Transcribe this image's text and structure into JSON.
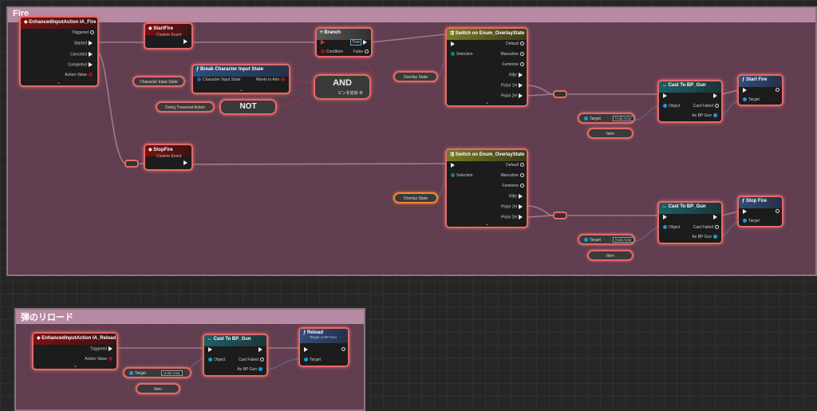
{
  "comments": {
    "fire_title": "Fire",
    "reload_title": "弾のリロード"
  },
  "fire": {
    "ia_fire": {
      "title": "EnhancedInputAction IA_Fire",
      "pins": [
        "Triggered",
        "Started",
        "Canceled",
        "Completed",
        "Action Value"
      ]
    },
    "start_fire_event": {
      "title": "StartFire",
      "subtitle": "Custom Event"
    },
    "stop_fire_event": {
      "title": "StopFire",
      "subtitle": "Custom Event"
    },
    "branch": {
      "title": "Branch",
      "condition": "Condition",
      "true": "True",
      "false": "False"
    },
    "break_state": {
      "title": "Break Character Input State",
      "in_pin": "Character Input State",
      "out_pin": "Wants to Aim"
    },
    "char_input_state_var": "Character Input State",
    "doing_traversal_var": "Doing Traversal Action",
    "not_label": "NOT",
    "and_label": "AND",
    "and_add_pin": "ピンを追加",
    "switch_top": {
      "title": "Switch on Enum_OverlayState",
      "selection": "Selection",
      "outs": [
        "Default",
        "Masculine",
        "Feminine",
        "Rifle",
        "Pistol 1H",
        "Pistol 2H"
      ]
    },
    "switch_bottom": {
      "title": "Switch on Enum_OverlayState",
      "selection": "Selection",
      "outs": [
        "Default",
        "Masculine",
        "Feminine",
        "Rifle",
        "Pistol 1H",
        "Pistol 2H"
      ]
    },
    "overlay_state_top": "Overlay State",
    "overlay_state_bottom": "Overlay State",
    "cast_top": {
      "title": "Cast To BP_Gun",
      "object": "Object",
      "failed": "Cast Failed",
      "as": "As BP Gun"
    },
    "cast_bottom": {
      "title": "Cast To BP_Gun",
      "object": "Object",
      "failed": "Cast Failed",
      "as": "As BP Gun"
    },
    "get_item_top": {
      "target": "Target",
      "value": "Hold Actor",
      "item": "Item"
    },
    "get_item_bottom": {
      "target": "Target",
      "value": "Hold Actor",
      "item": "Item"
    },
    "start_fire_call": {
      "title": "Start Fire",
      "target": "Target"
    },
    "stop_fire_call": {
      "title": "Stop Fire",
      "target": "Target"
    }
  },
  "reload": {
    "ia_reload": {
      "title": "EnhancedInputAction IA_Reload",
      "pins": [
        "Triggered",
        "Action Value"
      ]
    },
    "cast": {
      "title": "Cast To BP_Gun",
      "object": "Object",
      "failed": "Cast Failed",
      "as": "As BP Gun"
    },
    "get_item": {
      "target": "Target",
      "value": "Hold Actor",
      "item": "Item"
    },
    "reload_call": {
      "title": "Reload",
      "subtitle": "Target is BP Gun",
      "target": "Target"
    }
  },
  "colors": {
    "exec": "#ffffff",
    "bool": "#a11010",
    "object": "#1a9bdc",
    "struct": "#2a5fc0",
    "selection_outline": "#e26a6a",
    "enum": "#0a5b4e"
  },
  "icons": [
    "event-icon",
    "function-icon",
    "branch-icon",
    "switch-icon",
    "cast-icon",
    "exec-pin-icon",
    "data-pin-icon"
  ]
}
